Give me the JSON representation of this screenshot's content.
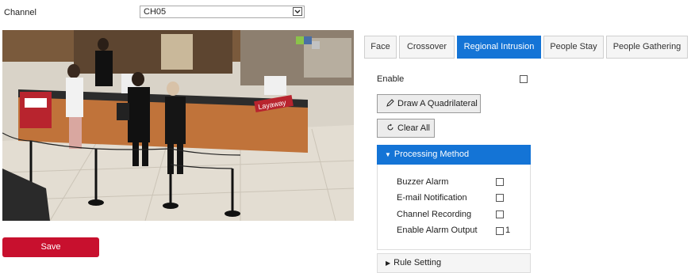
{
  "channel": {
    "label": "Channel",
    "selected": "CH05"
  },
  "preview": {
    "overlay_text": "Layaway"
  },
  "save_label": "Save",
  "tabs": [
    {
      "label": "Face"
    },
    {
      "label": "Crossover"
    },
    {
      "label": "Regional Intrusion",
      "active": true
    },
    {
      "label": "People Stay"
    },
    {
      "label": "People Gathering"
    }
  ],
  "panel": {
    "enable_label": "Enable",
    "draw_button": "Draw A Quadrilateral",
    "clear_button": "Clear All",
    "processing_title": "Processing Method",
    "options": [
      {
        "label": "Buzzer Alarm",
        "checked": false
      },
      {
        "label": "E-mail Notification",
        "checked": false
      },
      {
        "label": "Channel Recording",
        "checked": false
      },
      {
        "label": "Enable Alarm Output",
        "checked": false,
        "suffix": "1"
      }
    ],
    "rule_title": "Rule Setting"
  },
  "colors": {
    "accent": "#1474d6",
    "save": "#c8102e"
  },
  "icons": {
    "draw": "pencil-icon",
    "clear": "refresh-icon",
    "dropdown": "chevron-down-icon"
  }
}
